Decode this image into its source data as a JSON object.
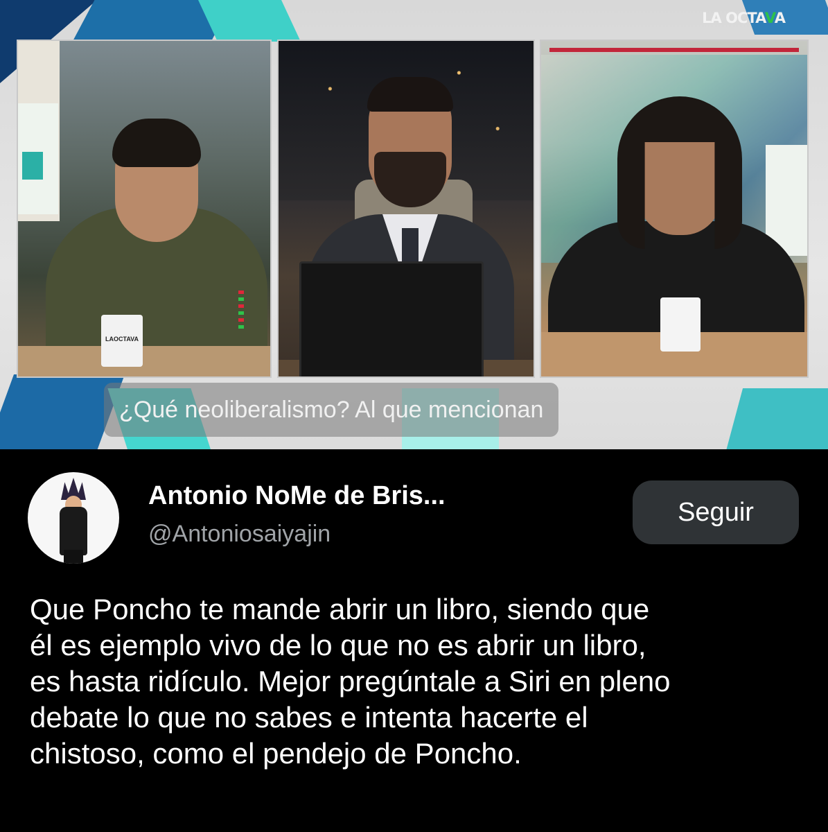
{
  "video": {
    "brand_prefix": "LA OCTA",
    "brand_accent": "V",
    "brand_suffix": "A",
    "mug_text": "LAOCTAVA",
    "caption": "¿Qué neoliberalismo? Al que mencionan"
  },
  "tweet": {
    "display_name": "Antonio NoMe de Bris...",
    "handle": "@Antoniosaiyajin",
    "follow_label": "Seguir",
    "text_lines": [
      "Que Poncho te mande abrir un libro, siendo que",
      "él es ejemplo vivo de lo que no es abrir un libro,",
      "es hasta ridículo. Mejor pregúntale a Siri en pleno",
      "debate lo que no sabes e intenta hacerte el",
      "chistoso, como el pendejo de Poncho."
    ]
  },
  "colors": {
    "background": "#000000",
    "follow_button_bg": "#2f3336",
    "handle_gray": "#a0a4a8",
    "brand_accent": "#2ec24a"
  },
  "icons": {
    "avatar": "avatar-image"
  }
}
